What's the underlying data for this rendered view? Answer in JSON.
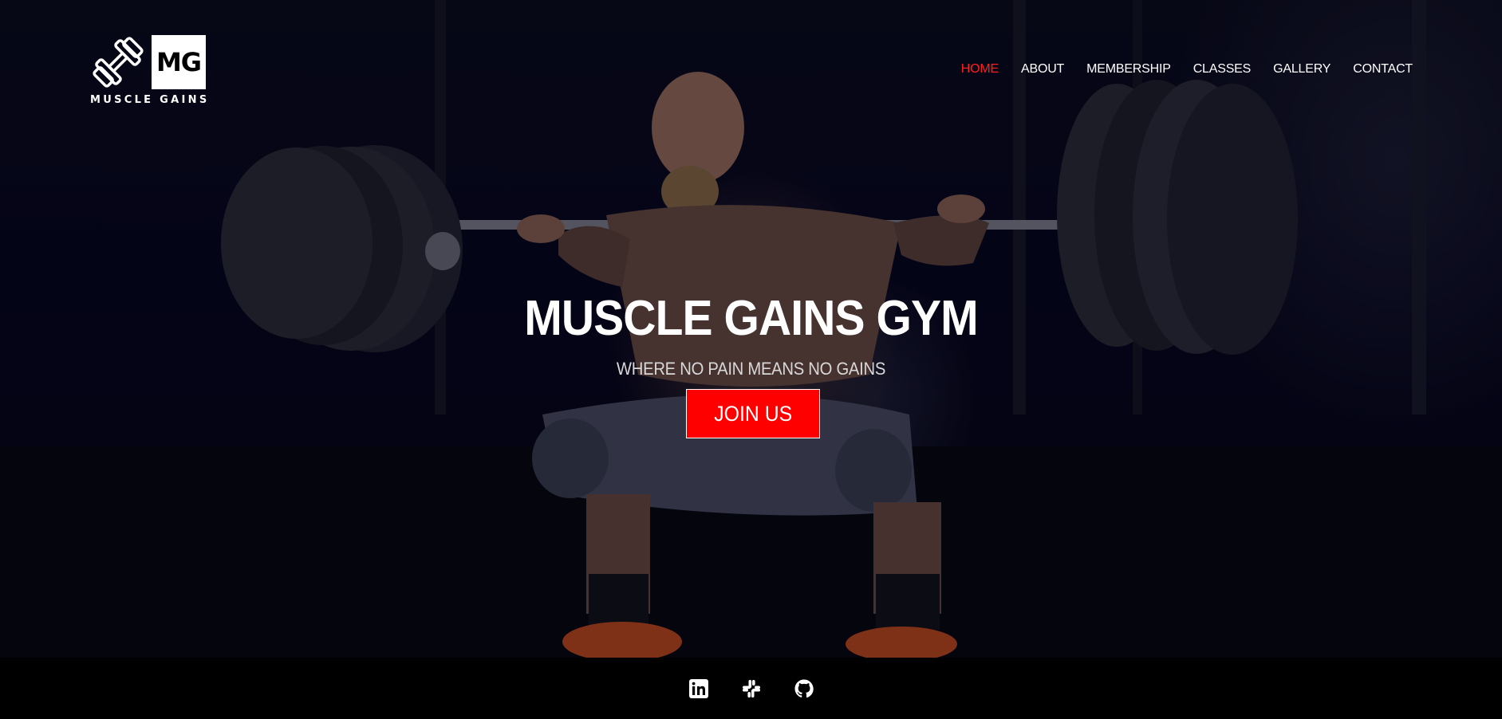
{
  "brand": {
    "logo_initials": "MG",
    "logo_text": "MUSCLE GAINS",
    "logo_icon": "dumbbell-icon"
  },
  "nav": {
    "items": [
      {
        "label": "HOME",
        "active": true
      },
      {
        "label": "ABOUT",
        "active": false
      },
      {
        "label": "MEMBERSHIP",
        "active": false
      },
      {
        "label": "CLASSES",
        "active": false
      },
      {
        "label": "GALLERY",
        "active": false
      },
      {
        "label": "CONTACT",
        "active": false
      }
    ]
  },
  "hero": {
    "title": "MUSCLE GAINS GYM",
    "subtitle": "WHERE NO PAIN MEANS NO GAINS",
    "cta_label": "JOIN US"
  },
  "footer": {
    "social": [
      {
        "icon": "linkedin-icon"
      },
      {
        "icon": "slack-icon"
      },
      {
        "icon": "github-icon"
      }
    ]
  },
  "colors": {
    "accent": "#ff0000",
    "active_nav": "#ff1f1f",
    "background": "#05050f",
    "footer": "#000000"
  }
}
